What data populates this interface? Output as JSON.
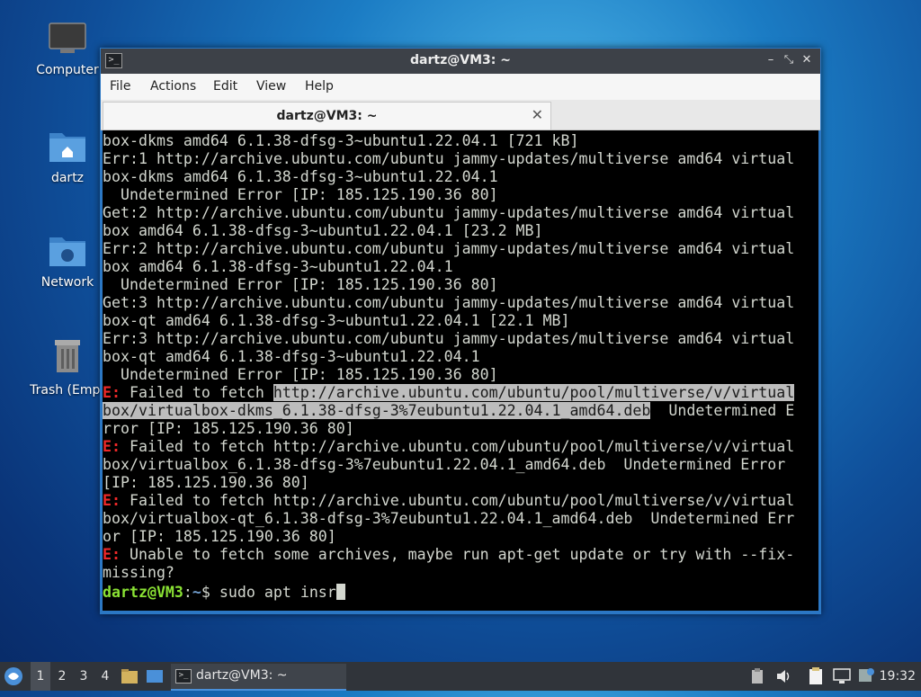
{
  "desktop": {
    "icons": [
      {
        "label": "Computer"
      },
      {
        "label": "dartz"
      },
      {
        "label": "Network"
      },
      {
        "label": "Trash (Empt"
      }
    ]
  },
  "window": {
    "title": "dartz@VM3: ~",
    "menu": [
      "File",
      "Actions",
      "Edit",
      "View",
      "Help"
    ],
    "tab": {
      "label": "dartz@VM3: ~"
    }
  },
  "terminal": {
    "lines": [
      {
        "segments": [
          {
            "text": "box-dkms amd64 6.1.38-dfsg-3~ubuntu1.22.04.1 [721 kB]"
          }
        ]
      },
      {
        "segments": [
          {
            "text": "Err:1 http://archive.ubuntu.com/ubuntu jammy-updates/multiverse amd64 virtual"
          }
        ]
      },
      {
        "segments": [
          {
            "text": "box-dkms amd64 6.1.38-dfsg-3~ubuntu1.22.04.1"
          }
        ]
      },
      {
        "segments": [
          {
            "text": "  Undetermined Error [IP: 185.125.190.36 80]"
          }
        ]
      },
      {
        "segments": [
          {
            "text": "Get:2 http://archive.ubuntu.com/ubuntu jammy-updates/multiverse amd64 virtual"
          }
        ]
      },
      {
        "segments": [
          {
            "text": "box amd64 6.1.38-dfsg-3~ubuntu1.22.04.1 [23.2 MB]"
          }
        ]
      },
      {
        "segments": [
          {
            "text": "Err:2 http://archive.ubuntu.com/ubuntu jammy-updates/multiverse amd64 virtual"
          }
        ]
      },
      {
        "segments": [
          {
            "text": "box amd64 6.1.38-dfsg-3~ubuntu1.22.04.1"
          }
        ]
      },
      {
        "segments": [
          {
            "text": "  Undetermined Error [IP: 185.125.190.36 80]"
          }
        ]
      },
      {
        "segments": [
          {
            "text": "Get:3 http://archive.ubuntu.com/ubuntu jammy-updates/multiverse amd64 virtual"
          }
        ]
      },
      {
        "segments": [
          {
            "text": "box-qt amd64 6.1.38-dfsg-3~ubuntu1.22.04.1 [22.1 MB]"
          }
        ]
      },
      {
        "segments": [
          {
            "text": "Err:3 http://archive.ubuntu.com/ubuntu jammy-updates/multiverse amd64 virtual"
          }
        ]
      },
      {
        "segments": [
          {
            "text": "box-qt amd64 6.1.38-dfsg-3~ubuntu1.22.04.1"
          }
        ]
      },
      {
        "segments": [
          {
            "text": "  Undetermined Error [IP: 185.125.190.36 80]"
          }
        ]
      },
      {
        "segments": [
          {
            "text": "E:",
            "cls": "err-e"
          },
          {
            "text": " Failed to fetch "
          },
          {
            "text": "http://archive.ubuntu.com/ubuntu/pool/multiverse/v/virtual",
            "cls": "sel"
          }
        ]
      },
      {
        "segments": [
          {
            "text": "box/virtualbox-dkms_6.1.38-dfsg-3%7eubuntu1.22.04.1_amd64.deb",
            "cls": "sel"
          },
          {
            "text": "  Undetermined E"
          }
        ]
      },
      {
        "segments": [
          {
            "text": "rror [IP: 185.125.190.36 80]"
          }
        ]
      },
      {
        "segments": [
          {
            "text": "E:",
            "cls": "err-e"
          },
          {
            "text": " Failed to fetch http://archive.ubuntu.com/ubuntu/pool/multiverse/v/virtual"
          }
        ]
      },
      {
        "segments": [
          {
            "text": "box/virtualbox_6.1.38-dfsg-3%7eubuntu1.22.04.1_amd64.deb  Undetermined Error"
          }
        ]
      },
      {
        "segments": [
          {
            "text": "[IP: 185.125.190.36 80]"
          }
        ]
      },
      {
        "segments": [
          {
            "text": "E:",
            "cls": "err-e"
          },
          {
            "text": " Failed to fetch http://archive.ubuntu.com/ubuntu/pool/multiverse/v/virtual"
          }
        ]
      },
      {
        "segments": [
          {
            "text": "box/virtualbox-qt_6.1.38-dfsg-3%7eubuntu1.22.04.1_amd64.deb  Undetermined Err"
          }
        ]
      },
      {
        "segments": [
          {
            "text": "or [IP: 185.125.190.36 80]"
          }
        ]
      },
      {
        "segments": [
          {
            "text": "E:",
            "cls": "err-e"
          },
          {
            "text": " Unable to fetch some archives, maybe run apt-get update or try with --fix-"
          }
        ]
      },
      {
        "segments": [
          {
            "text": "missing?"
          }
        ]
      }
    ],
    "prompt": {
      "user_host": "dartz@VM3",
      "colon": ":",
      "path": "~",
      "symbol": "$",
      "command": " sudo apt insr"
    }
  },
  "taskbar": {
    "workspaces": [
      "1",
      "2",
      "3",
      "4"
    ],
    "task_label": "dartz@VM3: ~",
    "clock": "19:32"
  }
}
